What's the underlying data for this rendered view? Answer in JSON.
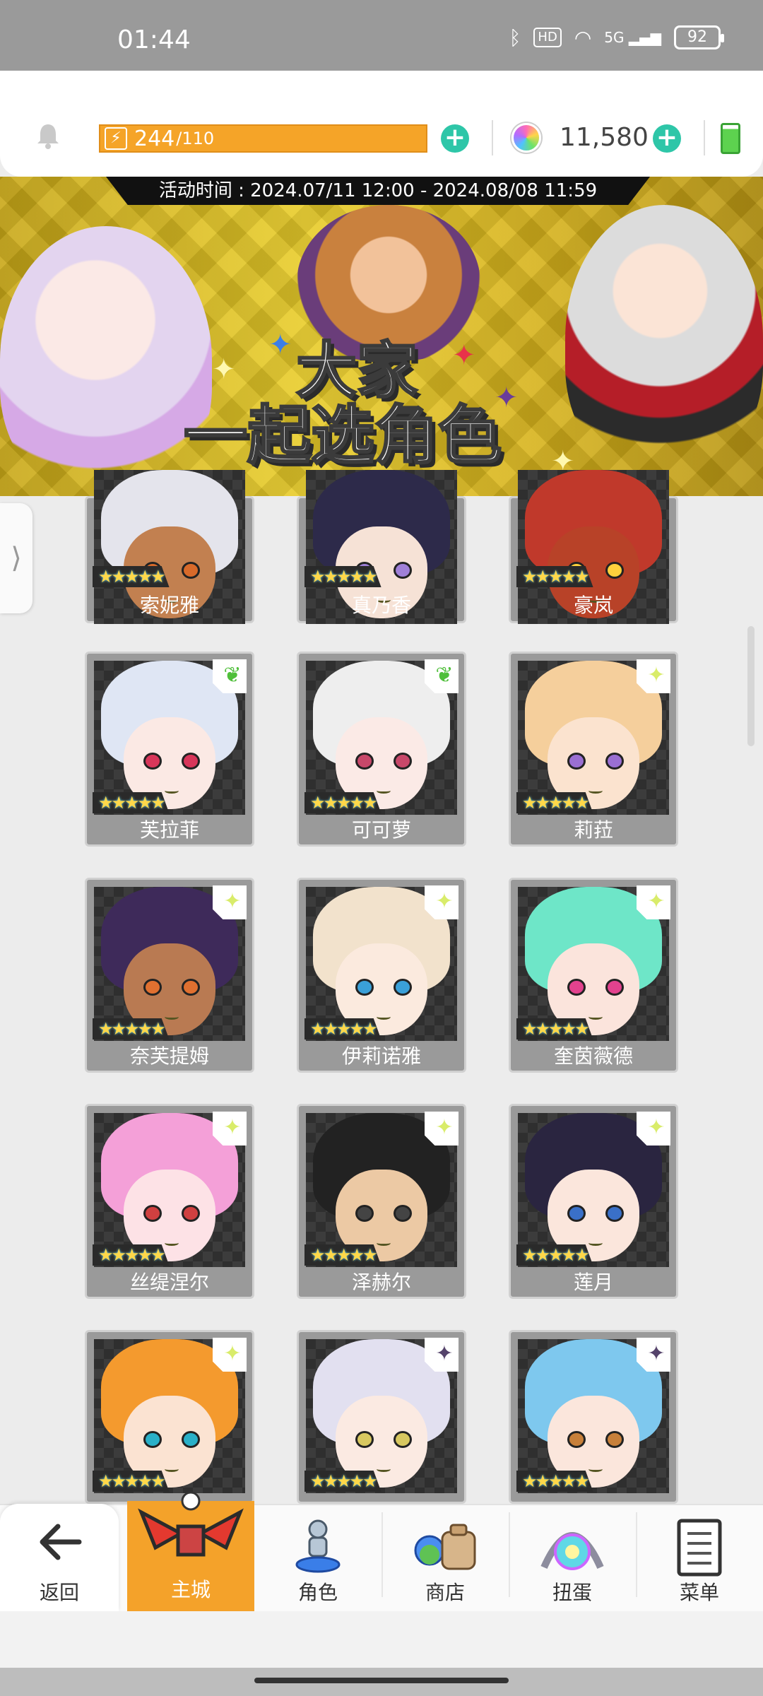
{
  "status_bar": {
    "time": "01:44",
    "network": "5G",
    "hd": "HD",
    "battery": "92"
  },
  "resources": {
    "energy_current": "244",
    "energy_max": "/110",
    "gems": "11,580"
  },
  "banner": {
    "event_time": "活动时间 : 2024.07/11 12:00 - 2024.08/08 11:59",
    "title_line1": "大家",
    "title_line2": "一起选角色"
  },
  "characters": [
    {
      "name": "索妮雅",
      "hair": "#e4e4ec",
      "skin": "#c28050",
      "eye": "#d86a2a",
      "badge": ""
    },
    {
      "name": "真乃香",
      "hair": "#2d2a4a",
      "skin": "#f6e2d6",
      "eye": "#a080d8",
      "badge": ""
    },
    {
      "name": "豪岚",
      "hair": "#c0392b",
      "skin": "#b84228",
      "eye": "#ffd23c",
      "badge": ""
    },
    {
      "name": "芙拉菲",
      "hair": "#dfe6f4",
      "skin": "#fbe9e4",
      "eye": "#d8365a",
      "badge": "leaf"
    },
    {
      "name": "可可萝",
      "hair": "#eeeeee",
      "skin": "#fbeae6",
      "eye": "#c8486a",
      "badge": "leaf"
    },
    {
      "name": "莉菈",
      "hair": "#f5cf9c",
      "skin": "#fbe3cf",
      "eye": "#9a6fd2",
      "badge": "sparkle-y"
    },
    {
      "name": "奈芙提姆",
      "hair": "#3e2a5a",
      "skin": "#b97a52",
      "eye": "#e07030",
      "badge": "sparkle-y"
    },
    {
      "name": "伊莉诺雅",
      "hair": "#f2e2cc",
      "skin": "#fbeade",
      "eye": "#3aa0d8",
      "badge": "sparkle-y"
    },
    {
      "name": "奎茵薇德",
      "hair": "#6ee6c8",
      "skin": "#fbe4dc",
      "eye": "#e2428e",
      "badge": "sparkle-y"
    },
    {
      "name": "丝缇涅尔",
      "hair": "#f4a0d8",
      "skin": "#fde2e6",
      "eye": "#d04040",
      "badge": "sparkle-y"
    },
    {
      "name": "泽赫尔",
      "hair": "#222222",
      "skin": "#ecc9a4",
      "eye": "#444444",
      "badge": "sparkle-y"
    },
    {
      "name": "莲月",
      "hair": "#2a2540",
      "skin": "#fbe6dc",
      "eye": "#3a70c8",
      "badge": "sparkle-y"
    },
    {
      "name": "",
      "hair": "#f49a2e",
      "skin": "#fbe3d2",
      "eye": "#2ab0c8",
      "badge": "sparkle-y"
    },
    {
      "name": "",
      "hair": "#e2e0f0",
      "skin": "#fbeae2",
      "eye": "#d8c860",
      "badge": "sparkle-d"
    },
    {
      "name": "",
      "hair": "#7ec8ee",
      "skin": "#fbe6dc",
      "eye": "#c8803a",
      "badge": "sparkle-d"
    }
  ],
  "bottom_nav": [
    {
      "label": "返回",
      "icon": "back-arrow-icon"
    },
    {
      "label": "主城",
      "icon": "castle-wings-icon"
    },
    {
      "label": "角色",
      "icon": "character-figure-icon"
    },
    {
      "label": "商店",
      "icon": "shop-bag-icon"
    },
    {
      "label": "扭蛋",
      "icon": "gacha-orb-icon"
    },
    {
      "label": "菜单",
      "icon": "menu-list-icon"
    }
  ],
  "colors": {
    "accent_orange": "#f4a22a",
    "plus_green": "#2ec6a8",
    "banner_gold": "#e9cd2a"
  }
}
